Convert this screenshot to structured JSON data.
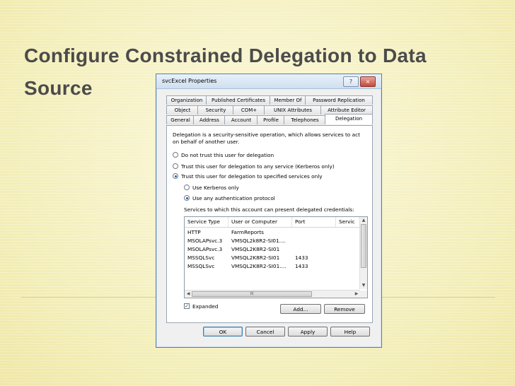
{
  "slide": {
    "title": "Configure Constrained Delegation to Data Source"
  },
  "dialog": {
    "title": "svcExcel Properties",
    "help_btn": "?",
    "close_btn": "×",
    "tabs_row1": [
      "Organization",
      "Published Certificates",
      "Member Of",
      "Password Replication"
    ],
    "tabs_row2": [
      "Object",
      "Security",
      "COM+",
      "UNIX Attributes",
      "Attribute Editor"
    ],
    "tabs_row3": [
      "General",
      "Address",
      "Account",
      "Profile",
      "Telephones",
      "Delegation"
    ],
    "active_tab": "Delegation",
    "description": "Delegation is a security-sensitive operation, which allows services to act on behalf of another user.",
    "options": {
      "no_trust": "Do not trust this user for delegation",
      "trust_any": "Trust this user for delegation to any service (Kerberos only)",
      "trust_specified": "Trust this user for delegation to specified services only",
      "kerberos_only": "Use Kerberos only",
      "any_protocol": "Use any authentication protocol"
    },
    "services_label": "Services to which this account can present delegated credentials:",
    "columns": [
      "Service Type",
      "User or Computer",
      "Port",
      "Servic"
    ],
    "rows": [
      [
        "HTTP",
        "FarmReports",
        "",
        ""
      ],
      [
        "MSOLAPsvc.3",
        "VMSQL2k8R2-SI01....",
        "",
        ""
      ],
      [
        "MSOLAPsvc.3",
        "VMSQL2K8R2-SI01",
        "",
        ""
      ],
      [
        "MSSQLSvc",
        "VMSQL2K8R2-SI01",
        "1433",
        ""
      ],
      [
        "MSSQLSvc",
        "VMSQL2K8R2-SI01....",
        "1433",
        ""
      ]
    ],
    "expanded_label": "Expanded",
    "add_label": "Add...",
    "remove_label": "Remove",
    "ok_label": "OK",
    "cancel_label": "Cancel",
    "apply_label": "Apply",
    "help_label": "Help",
    "scroll_grip": "III"
  },
  "colors": {
    "background": "#f7f3c8",
    "title_text": "#4b4b4b",
    "dialog_border": "#5b7fa5"
  }
}
